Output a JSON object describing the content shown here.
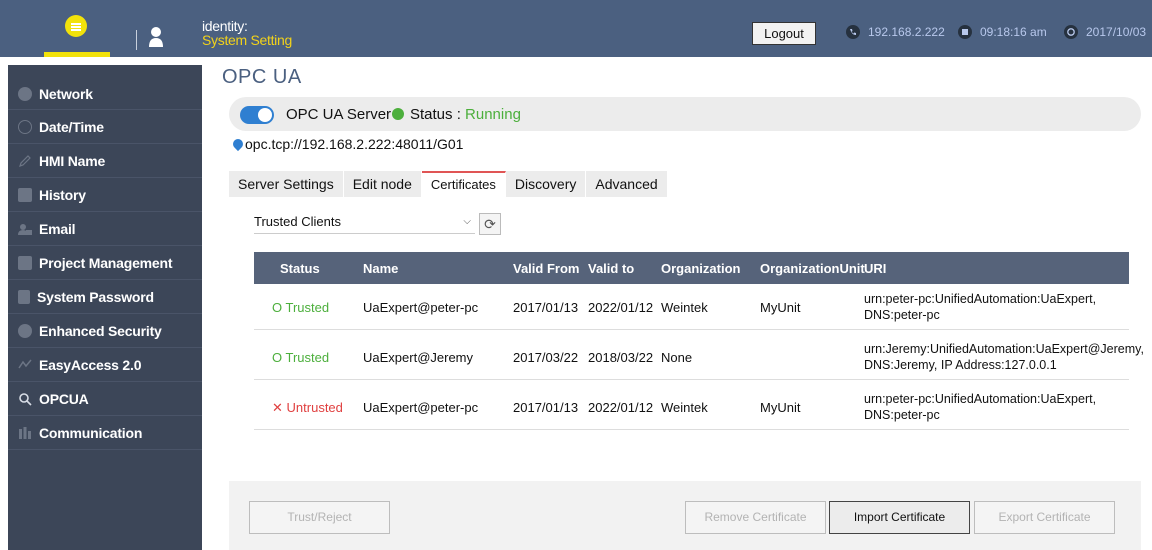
{
  "header": {
    "identity_label": "identity:",
    "identity_value": "System Setting",
    "logout_label": "Logout",
    "ip": "192.168.2.222",
    "time": "09:18:16 am",
    "date": "2017/10/03"
  },
  "sidebar": {
    "items": [
      {
        "label": "Network",
        "icon": "network-icon"
      },
      {
        "label": "Date/Time",
        "icon": "clock-icon"
      },
      {
        "label": "HMI Name",
        "icon": "pencil-icon"
      },
      {
        "label": "History",
        "icon": "document-icon"
      },
      {
        "label": "Email",
        "icon": "users-icon"
      },
      {
        "label": "Project Management",
        "icon": "project-icon"
      },
      {
        "label": "System Password",
        "icon": "lock-icon"
      },
      {
        "label": "Enhanced Security",
        "icon": "security-icon"
      },
      {
        "label": "EasyAccess 2.0",
        "icon": "remote-icon"
      },
      {
        "label": "OPCUA",
        "icon": "opcua-icon"
      },
      {
        "label": "Communication",
        "icon": "communication-icon"
      }
    ]
  },
  "page": {
    "title": "OPC UA",
    "server_label": "OPC UA Server",
    "status_label": "Status : ",
    "status_value": "Running",
    "server_enabled": true,
    "endpoint_url": "opc.tcp://192.168.2.222:48011/G01"
  },
  "tabs": [
    {
      "label": "Server Settings"
    },
    {
      "label": "Edit node"
    },
    {
      "label": "Certificates",
      "active": true
    },
    {
      "label": "Discovery"
    },
    {
      "label": "Advanced"
    }
  ],
  "certificates": {
    "filter_value": "Trusted Clients",
    "columns": [
      "Status",
      "Name",
      "Valid From",
      "Valid to",
      "Organization",
      "OrganizationUnit",
      "URI"
    ],
    "rows": [
      {
        "status": "Trusted",
        "trusted": true,
        "name": "UaExpert@peter-pc",
        "valid_from": "2017/01/13",
        "valid_to": "2022/01/12",
        "organization": "Weintek",
        "org_unit": "MyUnit",
        "uri_line1": "urn:peter-pc:UnifiedAutomation:UaExpert,",
        "uri_line2": "DNS:peter-pc"
      },
      {
        "status": "Trusted",
        "trusted": true,
        "name": "UaExpert@Jeremy",
        "valid_from": "2017/03/22",
        "valid_to": "2018/03/22",
        "organization": "None",
        "org_unit": "",
        "uri_line1": "urn:Jeremy:UnifiedAutomation:UaExpert@Jeremy,",
        "uri_line2": "DNS:Jeremy, IP Address:127.0.0.1"
      },
      {
        "status": "Untrusted",
        "trusted": false,
        "name": "UaExpert@peter-pc",
        "valid_from": "2017/01/13",
        "valid_to": "2022/01/12",
        "organization": "Weintek",
        "org_unit": "MyUnit",
        "uri_line1": "urn:peter-pc:UnifiedAutomation:UaExpert,",
        "uri_line2": "DNS:peter-pc"
      }
    ]
  },
  "actions": {
    "trust_reject": "Trust/Reject",
    "remove": "Remove Certificate",
    "import": "Import Certificate",
    "export": "Export Certificate"
  },
  "colors": {
    "topbar": "#4b6080",
    "sidebar": "#3c4658",
    "accent_yellow": "#f2e20a",
    "trusted_green": "#4caf3c",
    "untrusted_red": "#e04040",
    "toggle_blue": "#2f7fd1"
  }
}
